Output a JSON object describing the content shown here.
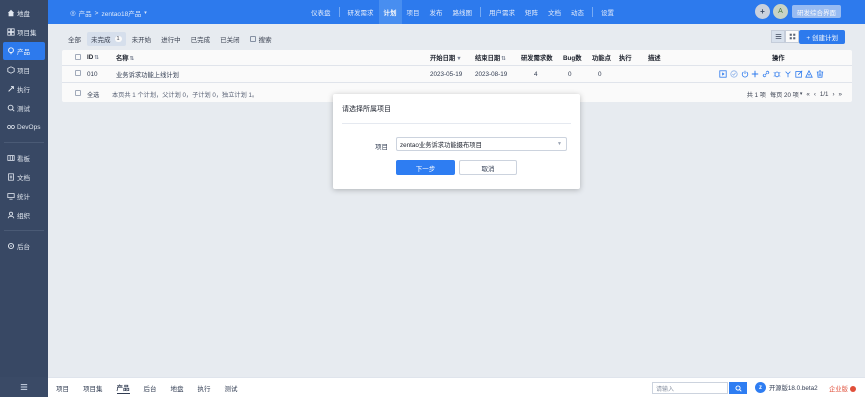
{
  "sidebar": {
    "items": [
      {
        "label": "地盘",
        "icon": "home-icon"
      },
      {
        "label": "项目集",
        "icon": "grid-icon"
      },
      {
        "label": "产品",
        "icon": "product-icon",
        "active": true
      },
      {
        "label": "项目",
        "icon": "project-icon"
      },
      {
        "label": "执行",
        "icon": "execution-icon"
      },
      {
        "label": "测试",
        "icon": "test-icon"
      },
      {
        "label": "DevOps",
        "icon": "devops-icon"
      },
      {
        "label": "看板",
        "icon": "kanban-icon"
      },
      {
        "label": "文档",
        "icon": "doc-icon"
      },
      {
        "label": "统计",
        "icon": "stats-icon"
      },
      {
        "label": "组织",
        "icon": "org-icon"
      },
      {
        "label": "后台",
        "icon": "settings-icon"
      }
    ]
  },
  "header": {
    "breadcrumb_root": "产品",
    "breadcrumb_product": "zentao18产品",
    "nav": [
      "仪表盘",
      "研发需求",
      "计划",
      "项目",
      "发布",
      "路线图",
      "用户需求",
      "矩阵",
      "文档",
      "动态",
      "设置"
    ],
    "active_nav": "计划",
    "avatar_letter": "A",
    "team_button": "研发综合界面"
  },
  "toolbar": {
    "tabs": [
      "全部",
      "未完成",
      "未开始",
      "进行中",
      "已完成",
      "已关闭"
    ],
    "active_count": "1",
    "search_label": "搜索",
    "create_label": "+ 创建计划"
  },
  "table": {
    "headers": {
      "id": "ID",
      "name": "名称",
      "start": "开始日期",
      "end": "结束日期",
      "stories": "研发需求数",
      "bugs": "Bug数",
      "points": "功能点",
      "exec": "执行",
      "desc": "描述",
      "actions": "操作"
    },
    "rows": [
      {
        "id": "010",
        "name": "业务诉求功能上线计划",
        "start": "2023-05-19",
        "end": "2023-08-19",
        "stories": "4",
        "bugs": "0",
        "points": "0"
      }
    ],
    "select_all": "全选",
    "summary": "本页共 1 个计划，父计划 0，子计划 0，独立计划 1。",
    "pager": {
      "total": "共 1 项",
      "per_page": "每页 20 项",
      "page": "1/1"
    }
  },
  "modal": {
    "title": "请选择所属项目",
    "label": "项目",
    "selected": "zentao业务诉求功能摄布项目",
    "next": "下一步",
    "cancel": "取消"
  },
  "footer": {
    "nav": [
      "项目",
      "项目集",
      "产品",
      "后台",
      "地盘",
      "执行",
      "测试"
    ],
    "active": "产品",
    "search_placeholder": "请输入",
    "version": "开源版18.0.beta2",
    "edition": "企业版"
  },
  "colors": {
    "primary": "#2e7df2",
    "sidebar": "#3a4a66",
    "edition": "#e04f3a"
  }
}
